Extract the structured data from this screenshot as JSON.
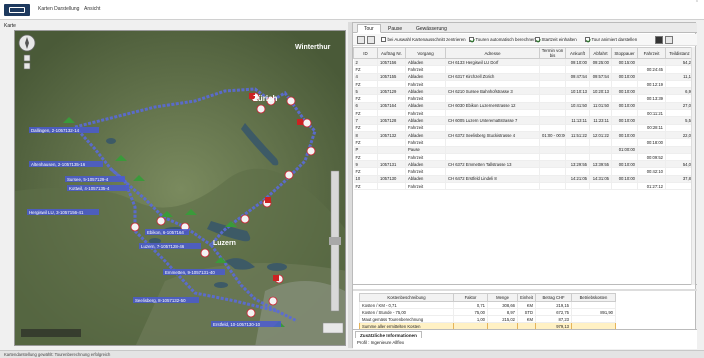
{
  "menu": [
    "Karten Darstellung",
    "Ansicht"
  ],
  "kartelbl": "Karte",
  "tabs": [
    "Tour",
    "Pause",
    "Gewässerung"
  ],
  "checks": [
    {
      "label": "bei Auswahl Kartenausschnitt zentrieren",
      "checked": false
    },
    {
      "label": "Touren automatisch berechnen",
      "checked": true
    },
    {
      "label": "Startzeit einhalten",
      "checked": true
    },
    {
      "label": "Tour animiert darstellen",
      "checked": true
    }
  ],
  "grid": {
    "headers": [
      "ID",
      "Auftrag Nr.",
      "Vorgang",
      "Adresse",
      "Termin von bis",
      "Ankunft",
      "Abfahrt",
      "Stoppauer",
      "Fahrzeit",
      "Teildistanz"
    ],
    "rows": [
      [
        "2",
        "1057156",
        "Abladen",
        "CH 6133 Hergiswil LU Dorf",
        "",
        "09:10:00",
        "09:25:00",
        "00:15:00",
        "",
        "54,2"
      ],
      [
        "FZ",
        "",
        "Fahrzeit",
        "",
        "",
        "",
        "",
        "",
        "00:24:45",
        ""
      ],
      [
        "4",
        "1057155",
        "Abladen",
        "CH 6317 Kirchzell Zürich",
        "",
        "09:47:54",
        "09:57:54",
        "00:10:00",
        "",
        "11,1"
      ],
      [
        "FZ",
        "",
        "Fahrzeit",
        "",
        "",
        "",
        "",
        "",
        "00:12:19",
        ""
      ],
      [
        "5",
        "1057129",
        "Abladen",
        "CH 6210 Sursee Bahnhofstrasse 3",
        "",
        "10:10:13",
        "10:20:13",
        "00:10:00",
        "",
        "6,9"
      ],
      [
        "FZ",
        "",
        "Fahrzeit",
        "",
        "",
        "",
        "",
        "",
        "00:13:39",
        ""
      ],
      [
        "6",
        "1057164",
        "Abladen",
        "CH 6030 Ebikon Luzernerstrasse 12",
        "",
        "10:41:50",
        "11:01:50",
        "00:10:00",
        "",
        "27,0"
      ],
      [
        "FZ",
        "",
        "Fahrzeit",
        "",
        "",
        "",
        "",
        "",
        "00:11:21",
        ""
      ],
      [
        "7",
        "1057128",
        "Abladen",
        "CH 6005 Luzern Unteremattstrasse 7",
        "",
        "11:13:11",
        "11:23:11",
        "00:10:00",
        "",
        "5,5"
      ],
      [
        "FZ",
        "",
        "Fahrzeit",
        "",
        "",
        "",
        "",
        "",
        "00:28:11",
        ""
      ],
      [
        "8",
        "1057132",
        "Abladen",
        "CH 6372 Seelisberg Stuckistrasse 4",
        "01:00 - 00:00",
        "11:51:22",
        "12:01:22",
        "00:10:00",
        "",
        "22,0"
      ],
      [
        "FZ",
        "",
        "Fahrzeit",
        "",
        "",
        "",
        "",
        "",
        "00:18:00",
        ""
      ],
      [
        "P",
        "",
        "Pause",
        "",
        "",
        "",
        "",
        "01:00:00",
        "",
        ""
      ],
      [
        "FZ",
        "",
        "Fahrzeit",
        "",
        "",
        "",
        "",
        "",
        "00:09:52",
        ""
      ],
      [
        "9",
        "1057131",
        "Abladen",
        "CH 6372 Emmetten Tallstrasse 13",
        "",
        "13:29:55",
        "13:39:55",
        "00:10:00",
        "",
        "54,0"
      ],
      [
        "FZ",
        "",
        "Fahrzeit",
        "",
        "",
        "",
        "",
        "",
        "00:42:10",
        ""
      ],
      [
        "10",
        "1057130",
        "Abladen",
        "CH 6472 Erstfeld Lindeli 8",
        "",
        "14:21:05",
        "14:31:05",
        "00:10:00",
        "",
        "37,8"
      ],
      [
        "FZ",
        "",
        "Fahrzeit",
        "",
        "",
        "",
        "",
        "",
        "01:27:12",
        ""
      ]
    ]
  },
  "cost": {
    "headers": [
      "Kostenbeschreibung",
      "Faktor",
      "Menge",
      "Einheit",
      "Betrag CHF",
      "Betriebskosten"
    ],
    "rows": [
      [
        "Kosten / KM - 0,71",
        "0,71",
        "308,66",
        "KM",
        "219,15",
        ""
      ],
      [
        "Kosten / Stunde - 75,00",
        "75,00",
        "8,97",
        "STD",
        "672,75",
        "891,90"
      ],
      [
        "Maut gemäss Tourenberechnung",
        "1,00",
        "215,02",
        "KM",
        "87,23",
        ""
      ],
      [
        "Summe aller ermittelten Kosten",
        "",
        "",
        "",
        "979,13",
        ""
      ]
    ]
  },
  "zus": {
    "title": "Zusätzliche Informationen",
    "text": "Profil : Ingenieure Allflex"
  },
  "map": {
    "cities": [
      "Zürich",
      "Luzern",
      "Winterthur"
    ],
    "labels": [
      "Dallingen, 2-1057132-14",
      "Altenhausen, 2-1057135-16",
      "Sursee, 5-1057129-4",
      "Kottwil, 4-1057135-4",
      "Hergiswil LU, 3-1057156-41",
      "Ebikon, 6-1057164",
      "Luzern, 7-1057128-46",
      "Emmetten, 9-1057131-40",
      "Seelisberg, 8-1057132-50",
      "Erstfeld, 10-1057130-10"
    ],
    "route_color": "#5a6bd8"
  },
  "status": "Kartendarstellung gewählt: Tourenberechnung erfolgreich"
}
